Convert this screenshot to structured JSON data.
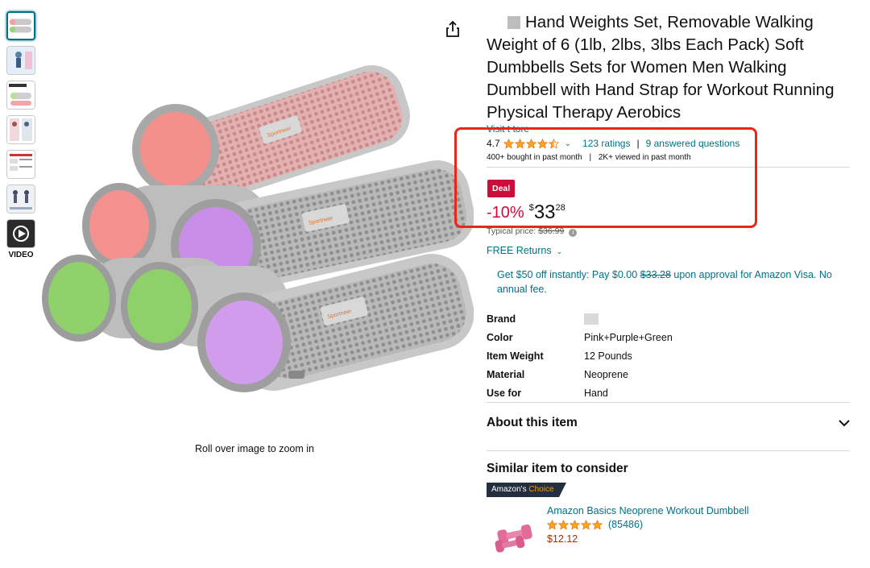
{
  "gallery": {
    "thumbnail_count": 7,
    "video_label": "VIDEO",
    "zoom_hint": "Roll over image to zoom in"
  },
  "product": {
    "title": "Hand Weights Set, Removable Walking Weight of 6 (1lb, 2lbs, 3lbs Each Pack) Soft Dumbbells Sets for Women Men Walking Dumbbell with Hand Strap for Workout Running Physical Therapy Aerobics",
    "visit_store": "Visit t              tore",
    "rating": "4.7",
    "rating_stars": 4.5,
    "ratings_count": "123 ratings",
    "answered_questions": "9 answered questions",
    "bought": "400+ bought in past month",
    "viewed": "2K+ viewed in past month"
  },
  "pricing": {
    "deal_label": "Deal",
    "discount": "-10%",
    "currency": "$",
    "whole": "33",
    "fraction": "28",
    "typical_label": "Typical price:",
    "typical_value": "$36.99",
    "free_returns": "FREE Returns",
    "promo_prefix": "Get $50 off instantly: Pay $0.00",
    "promo_strike": "$33.28",
    "promo_suffix": "upon approval for Amazon Visa. No annual fee."
  },
  "specs": [
    {
      "key": "Brand",
      "value": ""
    },
    {
      "key": "Color",
      "value": "Pink+Purple+Green"
    },
    {
      "key": "Item Weight",
      "value": "12 Pounds"
    },
    {
      "key": "Material",
      "value": "Neoprene"
    },
    {
      "key": "Use for",
      "value": "Hand"
    }
  ],
  "about": {
    "title": "About this item"
  },
  "similar": {
    "section_title": "Similar item to consider",
    "badge_prefix": "Amazon's",
    "badge_choice": "Choice",
    "name": "Amazon Basics Neoprene Workout Dumbbell",
    "rating_stars": 5,
    "review_count": "(85486)",
    "price": "$12.12"
  },
  "colors": {
    "link": "#007185",
    "deal_red": "#cc0c39",
    "star": "#ffa41c",
    "highlight": "#e8271b"
  }
}
